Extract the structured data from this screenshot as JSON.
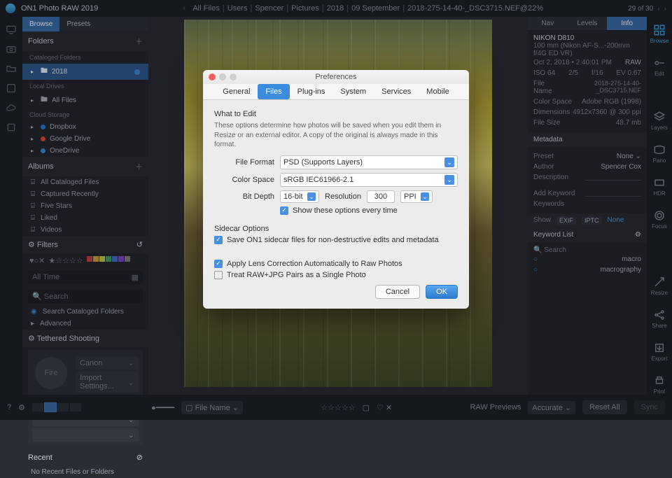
{
  "app": {
    "name": "ON1 Photo RAW 2019"
  },
  "breadcrumb": {
    "items": [
      "All Files",
      "Users",
      "Spencer",
      "Pictures",
      "2018",
      "09 September",
      "2018-275-14-40-_DSC3715.NEF@22%"
    ]
  },
  "counter": {
    "text": "29 of 30"
  },
  "leftTabs": {
    "browse": "Browse",
    "presets": "Presets"
  },
  "panels": {
    "folders": "Folders",
    "cataloged": "Cataloged Folders",
    "year": "2018",
    "localDrives": "Local Drives",
    "allFiles": "All Files",
    "cloud": "Cloud Storage",
    "dropbox": "Dropbox",
    "gdrive": "Google Drive",
    "onedrive": "OneDrive",
    "albums": "Albums",
    "allCataloged": "All Cataloged Files",
    "captured": "Captured Recently",
    "fiveStars": "Five Stars",
    "liked": "Liked",
    "videos": "Videos",
    "filters": "Filters",
    "allTime": "All Time",
    "searchPlaceholder": "Search",
    "searchCataloged": "Search Cataloged Folders",
    "advanced": "Advanced",
    "tethered": "Tethered Shooting",
    "fire": "Fire",
    "canon": "Canon",
    "importSettings": "Import Settings...",
    "recent": "Recent",
    "noRecent": "No Recent Files or Folders"
  },
  "rightRail": {
    "browse": "Browse",
    "edit": "Edit",
    "layers": "Layers",
    "pano": "Pano",
    "hdr": "HDR",
    "focus": "Focus",
    "resize": "Resize",
    "share": "Share",
    "export": "Export",
    "print": "Print",
    "sync": "Sync"
  },
  "info": {
    "tabs": {
      "nav": "Nav",
      "levels": "Levels",
      "info": "Info"
    },
    "camera": "NIKON D810",
    "lens": "100 mm (Nikon AF-S...-200mm f/4G ED VR)",
    "date": "Oct 2, 2018 • 2:40:01 PM",
    "raw": "RAW",
    "iso": "ISO 64",
    "shutter": "2/5",
    "aperture": "f/16",
    "ev": "EV 0.67",
    "filename_lbl": "File Name",
    "filename": "2018-275-14-40-_DSC3715.NEF",
    "colorspace_lbl": "Color Space",
    "colorspace": "Adobe RGB (1998)",
    "dimensions_lbl": "Dimensions",
    "dimensions": "4912x7360 @ 300 ppi",
    "filesize_lbl": "File Size",
    "filesize": "48.7 mb",
    "metadata": "Metadata",
    "preset_lbl": "Preset",
    "preset": "None",
    "author_lbl": "Author",
    "author": "Spencer Cox",
    "description_lbl": "Description",
    "addkw_lbl": "Add Keyword",
    "keywords_lbl": "Keywords",
    "show": "Show",
    "exif": "EXIF",
    "iptc": "IPTC",
    "none": "None",
    "kwlist": "Keyword List",
    "kw_search": "Search",
    "kw1": "macro",
    "kw2": "macrography"
  },
  "bottom": {
    "fileName": "File Name",
    "rawPreviews": "RAW Previews",
    "accurate": "Accurate",
    "resetAll": "Reset All",
    "sync": "Sync"
  },
  "modal": {
    "title": "Preferences",
    "tabs": {
      "general": "General",
      "files": "Files",
      "plugins": "Plug-ins",
      "system": "System",
      "services": "Services",
      "mobile": "Mobile"
    },
    "whatToEdit": "What to Edit",
    "hint": "These options determine how photos will be saved when you edit them in Resize or an external editor.  A copy of the original is always made in this format.",
    "fileFormat_lbl": "File Format",
    "fileFormat": "PSD (Supports Layers)",
    "colorSpace_lbl": "Color Space",
    "colorSpace": "sRGB IEC61966-2.1",
    "bitDepth_lbl": "Bit Depth",
    "bitDepth": "16-bit",
    "resolution_lbl": "Resolution",
    "resolution": "300",
    "ppi": "PPI",
    "showOptions": "Show these options every time",
    "sidecar": "Sidecar Options",
    "saveSidecar": "Save ON1 sidecar files for non-destructive edits and metadata",
    "applyLens": "Apply Lens Correction Automatically to Raw Photos",
    "treatRawJpg": "Treat RAW+JPG Pairs as a Single Photo",
    "cancel": "Cancel",
    "ok": "OK"
  }
}
